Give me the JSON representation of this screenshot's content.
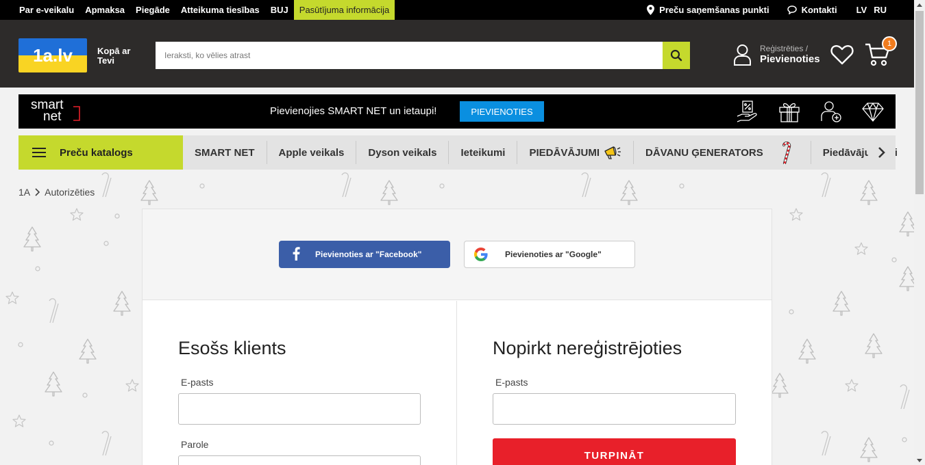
{
  "topbar": {
    "links": [
      "Par e-veikalu",
      "Apmaksa",
      "Piegāde",
      "Atteikuma tiesības",
      "BUJ",
      "Pasūtījuma informācija"
    ],
    "pickup_points": "Preču saņemšanas punkti",
    "contacts": "Kontakti",
    "lang_lv": "LV",
    "lang_ru": "RU"
  },
  "header": {
    "logo_text": "1a.lv",
    "tagline": "Kopā ar Tevi",
    "search_placeholder": "Ieraksti, ko vēlies atrast",
    "register_label": "Reģistrēties /",
    "login_label": "Pievienoties",
    "cart_count": "1"
  },
  "smartnet": {
    "logo_top": "smart",
    "logo_bottom": "net",
    "promo_text": "Pievienojies SMART NET un ietaupi!",
    "join_button": "PIEVIENOTIES"
  },
  "nav": {
    "catalog_label": "Preču katalogs",
    "items": [
      "SMART NET",
      "Apple veikals",
      "Dyson veikals",
      "Ieteikumi",
      "PIEDĀVĀJUMI",
      "DĀVANU ĢENERATORS",
      "Piedāvājums bi"
    ]
  },
  "breadcrumb": {
    "home": "1A",
    "current": "Autorizēties"
  },
  "login": {
    "facebook_button": "Pievienoties ar \"Facebook\"",
    "google_button": "Pievienoties ar \"Google\"",
    "existing_title": "Esošs klients",
    "existing_email_label": "E-pasts",
    "existing_password_label": "Parole",
    "guest_title": "Nopirkt nereģistrējoties",
    "guest_email_label": "E-pasts",
    "continue_button": "TURPINĀT"
  },
  "colors": {
    "accent_green": "#c5d92d",
    "smartnet_blue": "#0a8fe0",
    "facebook_blue": "#3b5ea8",
    "continue_red": "#e8202a",
    "header_dark": "#2d2b2a",
    "cart_badge": "#f07c1e"
  },
  "icons": [
    "location-pin-icon",
    "chat-bubble-icon",
    "search-icon",
    "user-icon",
    "heart-icon",
    "cart-icon",
    "discount-hand-icon",
    "gift-icon",
    "user-plus-icon",
    "diamond-icon",
    "hamburger-icon",
    "megaphone-icon",
    "candy-cane-icon",
    "chevron-right-icon",
    "facebook-icon",
    "google-icon"
  ]
}
